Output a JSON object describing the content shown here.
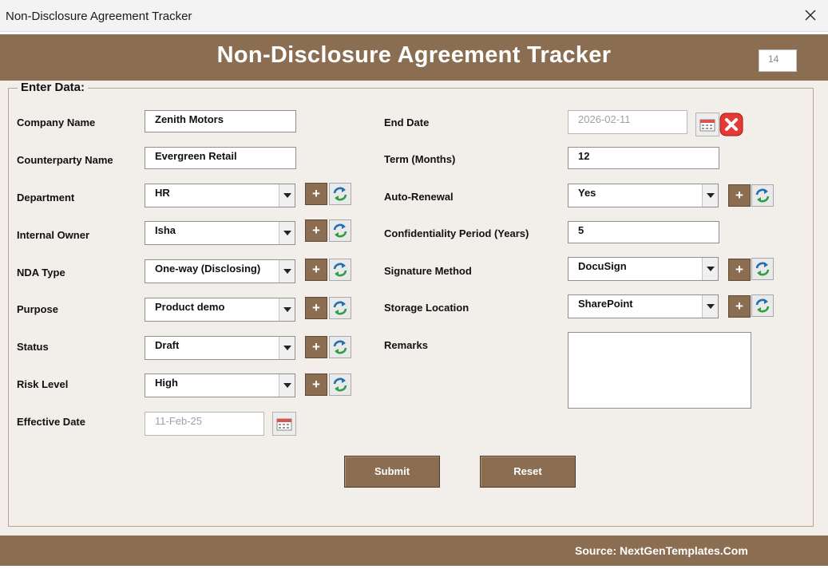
{
  "window": {
    "title": "Non-Disclosure Agreement Tracker"
  },
  "header": {
    "title": "Non-Disclosure Agreement Tracker",
    "record_counter": "14"
  },
  "form": {
    "legend": "Enter Data:",
    "left": {
      "company_name": {
        "label": "Company Name",
        "value": "Zenith Motors"
      },
      "counterparty_name": {
        "label": "Counterparty Name",
        "value": "Evergreen Retail"
      },
      "department": {
        "label": "Department",
        "value": "HR"
      },
      "internal_owner": {
        "label": "Internal Owner",
        "value": "Isha"
      },
      "nda_type": {
        "label": "NDA Type",
        "value": "One-way (Disclosing)"
      },
      "purpose": {
        "label": "Purpose",
        "value": "Product demo"
      },
      "status": {
        "label": "Status",
        "value": "Draft"
      },
      "risk_level": {
        "label": "Risk Level",
        "value": "High"
      },
      "effective_date": {
        "label": "Effective Date",
        "value": "11-Feb-25"
      }
    },
    "right": {
      "end_date": {
        "label": "End Date",
        "value": "2026-02-11"
      },
      "term_months": {
        "label": "Term (Months)",
        "value": "12"
      },
      "auto_renewal": {
        "label": "Auto-Renewal",
        "value": "Yes"
      },
      "confidentiality_period": {
        "label": "Confidentiality Period (Years)",
        "value": "5"
      },
      "signature_method": {
        "label": "Signature Method",
        "value": "DocuSign"
      },
      "storage_location": {
        "label": "Storage Location",
        "value": "SharePoint"
      },
      "remarks": {
        "label": "Remarks",
        "value": ""
      }
    },
    "add_button_glyph": "+",
    "submit_label": "Submit",
    "reset_label": "Reset"
  },
  "footer": {
    "source": "Source: NextGenTemplates.Com"
  },
  "colors": {
    "brand_brown": "#8b6e52",
    "form_bg": "#f2efeb",
    "close_red": "#e53935",
    "refresh_green": "#2e9e3e",
    "refresh_blue": "#1f6fb2"
  },
  "icons": [
    "close-icon",
    "calendar-icon",
    "clear-icon",
    "refresh-icon",
    "dropdown-arrow-icon",
    "plus-icon"
  ]
}
